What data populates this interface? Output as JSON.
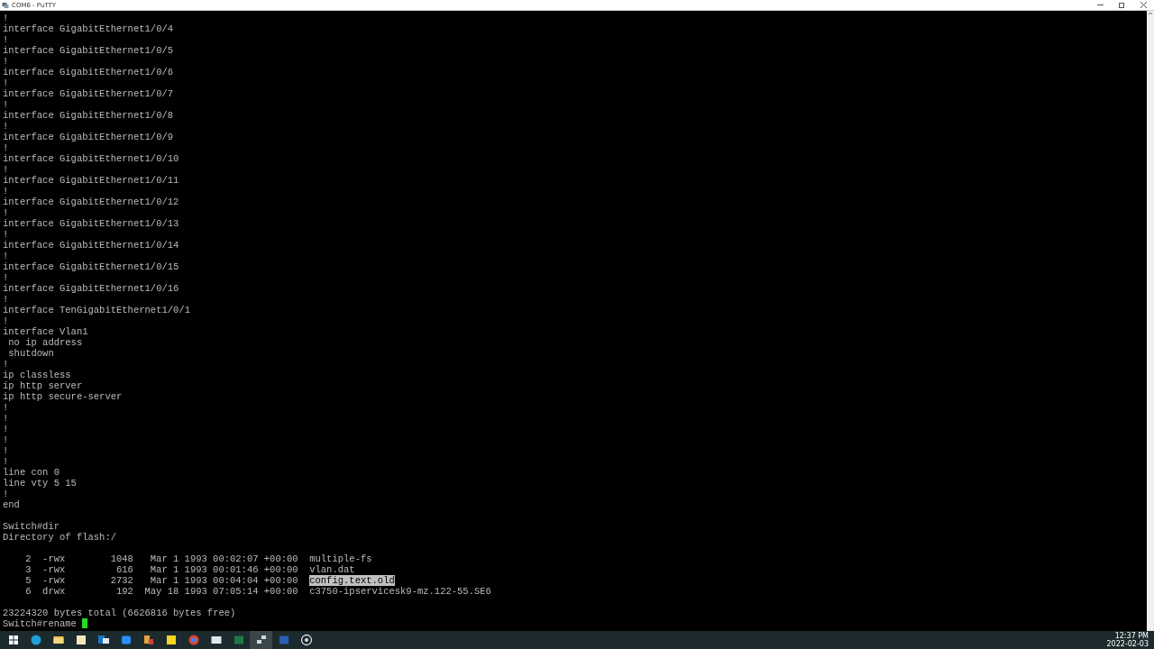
{
  "window": {
    "title": "COM6 - PuTTY"
  },
  "terminal": {
    "blocks": [
      [
        "!",
        "interface GigabitEthernet1/0/4",
        "!",
        "interface GigabitEthernet1/0/5",
        "!",
        "interface GigabitEthernet1/0/6",
        "!",
        "interface GigabitEthernet1/0/7",
        "!",
        "interface GigabitEthernet1/0/8",
        "!",
        "interface GigabitEthernet1/0/9",
        "!",
        "interface GigabitEthernet1/0/10",
        "!",
        "interface GigabitEthernet1/0/11",
        "!",
        "interface GigabitEthernet1/0/12",
        "!",
        "interface GigabitEthernet1/0/13",
        "!",
        "interface GigabitEthernet1/0/14",
        "!",
        "interface GigabitEthernet1/0/15",
        "!",
        "interface GigabitEthernet1/0/16",
        "!",
        "interface TenGigabitEthernet1/0/1",
        "!",
        "interface Vlan1",
        " no ip address",
        " shutdown",
        "!",
        "ip classless",
        "ip http server",
        "ip http secure-server",
        "!",
        "!",
        "!",
        "!",
        "!",
        "!",
        "line con 0",
        "line vty 5 15",
        "!",
        "end"
      ],
      [
        "Switch#dir",
        "Directory of flash:/"
      ]
    ],
    "listing": [
      {
        "number": "2",
        "perms": "-rwx",
        "size": "1048",
        "date": "Mar 1 1993 00:02:07 +00:00",
        "name": "multiple-fs",
        "selected": false
      },
      {
        "number": "3",
        "perms": "-rwx",
        "size": "616",
        "date": "Mar 1 1993 00:01:46 +00:00",
        "name": "vlan.dat",
        "selected": false
      },
      {
        "number": "5",
        "perms": "-rwx",
        "size": "2732",
        "date": "Mar 1 1993 00:04:04 +00:00",
        "name": "config.text.old",
        "selected": true
      },
      {
        "number": "6",
        "perms": "drwx",
        "size": "192",
        "date": "May 18 1993 07:05:14 +00:00",
        "name": "c3750-ipservicesk9-mz.122-55.SE6",
        "selected": false
      }
    ],
    "summary": "23224320 bytes total (6626816 bytes free)",
    "prompt": "Switch#rename "
  },
  "taskbar": {
    "clock": {
      "time": "12:37 PM",
      "date": "2022-02-03"
    }
  }
}
